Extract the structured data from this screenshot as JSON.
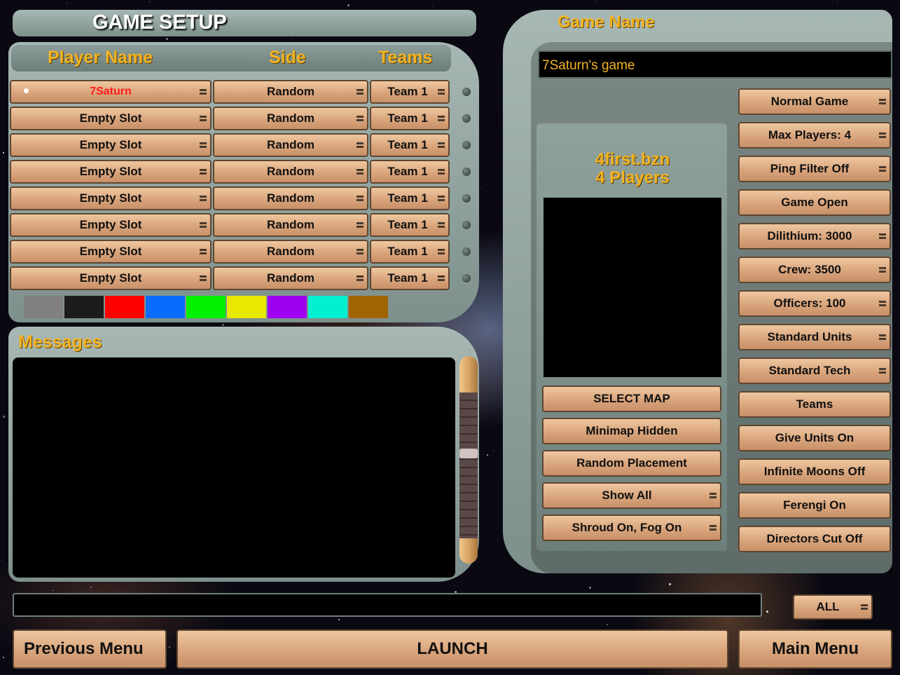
{
  "title": "GAME SETUP",
  "player_table": {
    "headers": {
      "name": "Player Name",
      "side": "Side",
      "teams": "Teams"
    },
    "rows": [
      {
        "name": "7Saturn",
        "side": "Random",
        "team": "Team 1",
        "highlight": true
      },
      {
        "name": "Empty Slot",
        "side": "Random",
        "team": "Team 1"
      },
      {
        "name": "Empty Slot",
        "side": "Random",
        "team": "Team 1"
      },
      {
        "name": "Empty Slot",
        "side": "Random",
        "team": "Team 1"
      },
      {
        "name": "Empty Slot",
        "side": "Random",
        "team": "Team 1"
      },
      {
        "name": "Empty Slot",
        "side": "Random",
        "team": "Team 1"
      },
      {
        "name": "Empty Slot",
        "side": "Random",
        "team": "Team 1"
      },
      {
        "name": "Empty Slot",
        "side": "Random",
        "team": "Team 1"
      }
    ],
    "colors": [
      "#808080",
      "#1c1c1c",
      "#ff0000",
      "#0a6cff",
      "#00f000",
      "#e8e800",
      "#a000f0",
      "#00f0d0",
      "#a06400"
    ]
  },
  "messages": {
    "title": "Messages"
  },
  "chat": {
    "filter": "ALL"
  },
  "game_name": {
    "label": "Game Name",
    "value": "7Saturn's game"
  },
  "map": {
    "file": "4first.bzn",
    "players": "4 Players"
  },
  "map_buttons": [
    "SELECT MAP",
    "Minimap Hidden",
    "Random Placement",
    "Show All",
    "Shroud On, Fog On"
  ],
  "options": [
    "Normal Game",
    "Max Players: 4",
    "Ping Filter Off",
    "Game Open",
    "Dilithium:  3000",
    "Crew:  3500",
    "Officers:  100",
    "Standard Units",
    "Standard Tech",
    "Teams",
    "Give Units On",
    "Infinite Moons Off",
    "Ferengi On",
    "Directors Cut Off"
  ],
  "nav": {
    "previous": "Previous Menu",
    "launch": "LAUNCH",
    "main": "Main Menu"
  },
  "colors": {
    "accent": "#f3b321",
    "button": "#e0b08a",
    "panel": "#95a7a3",
    "player_highlight": "#ff1a1a"
  }
}
